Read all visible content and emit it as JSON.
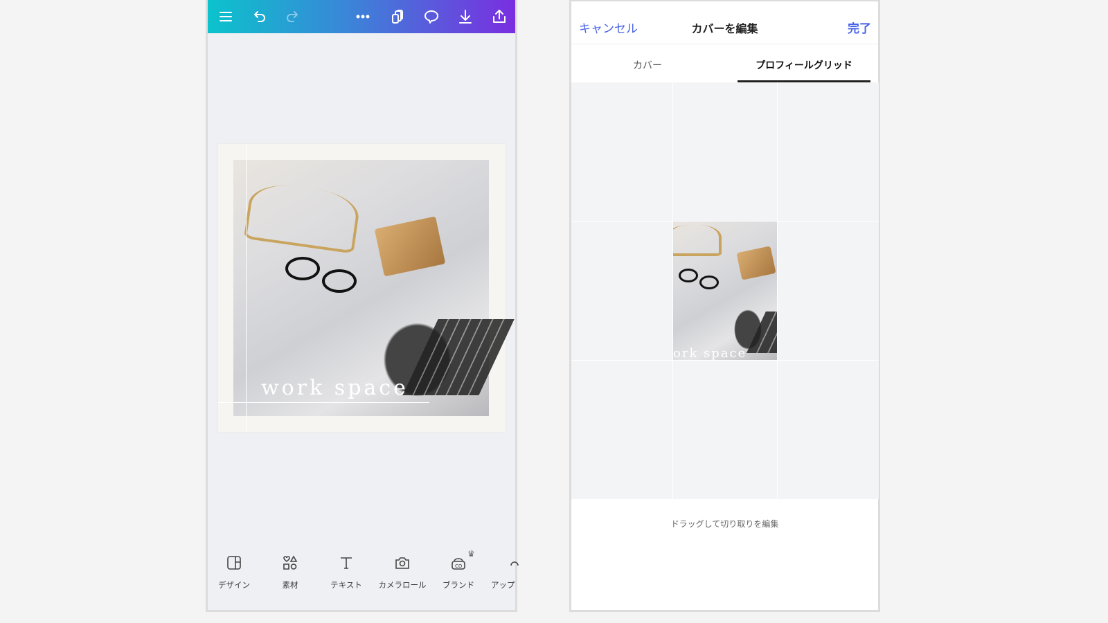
{
  "editor": {
    "toolbar": {
      "icons": [
        "menu-icon",
        "undo-icon",
        "redo-icon",
        "more-icon",
        "copy-pages-icon",
        "comment-icon",
        "download-icon",
        "share-icon"
      ],
      "gradient": [
        "#0bc3cc",
        "#7a2ee0"
      ]
    },
    "design": {
      "text": "work  space"
    },
    "bottom_nav": [
      {
        "label": "デザイン",
        "icon": "design-icon"
      },
      {
        "label": "素材",
        "icon": "elements-icon"
      },
      {
        "label": "テキスト",
        "icon": "text-icon"
      },
      {
        "label": "カメラロール",
        "icon": "camera-icon"
      },
      {
        "label": "ブランド",
        "icon": "brand-icon",
        "badge": "crown-icon"
      },
      {
        "label": "アップ",
        "icon": "upload-icon"
      }
    ]
  },
  "cover_editor": {
    "cancel_label": "キャンセル",
    "title": "カバーを編集",
    "done_label": "完了",
    "tabs": [
      {
        "label": "カバー",
        "active": false
      },
      {
        "label": "プロフィールグリッド",
        "active": true
      }
    ],
    "preview_text": "ork  space",
    "hint": "ドラッグして切り取りを編集",
    "accent": "#4a63e8"
  }
}
